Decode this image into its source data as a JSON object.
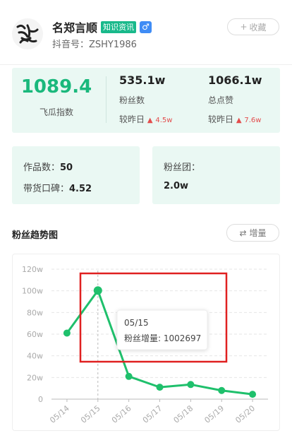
{
  "header": {
    "name": "名郑言顺",
    "tag": "知识资讯",
    "gender_icon": "male-icon",
    "gender_symbol": "♂",
    "douyin_id": "抖音号：ZSHY1986",
    "fav_label": "收藏",
    "avatar_text": "名郑言顺"
  },
  "stats": {
    "feigua_value": "1089.4",
    "feigua_label": "飞瓜指数",
    "fans_value": "535.1w",
    "fans_label": "粉丝数",
    "fans_cmp_label": "较昨日",
    "fans_cmp_value": "4.5w",
    "likes_value": "1066.1w",
    "likes_label": "总点赞",
    "likes_cmp_label": "较昨日",
    "likes_cmp_value": "7.6w"
  },
  "cards": {
    "works_label": "作品数：",
    "works_value": "50",
    "reputation_label": "带货口碑：",
    "reputation_value": "4.52",
    "fan_group_label": "粉丝团：",
    "fan_group_value": "2.0w"
  },
  "trend": {
    "title": "粉丝趋势图",
    "toggle_label": "增量",
    "toggle_icon": "swap-icon"
  },
  "colors": {
    "accent": "#19b98b",
    "line": "#1fc06c",
    "up_arrow": "#e34d4d",
    "highlight_box": "#e02020"
  },
  "chart_data": {
    "type": "line",
    "categories": [
      "05/14",
      "05/15",
      "05/16",
      "05/17",
      "05/18",
      "05/19",
      "05/20"
    ],
    "series": [
      {
        "name": "粉丝增量",
        "values": [
          610000,
          1002697,
          210000,
          110000,
          135000,
          80000,
          45000
        ]
      }
    ],
    "yticks": [
      "0",
      "20w",
      "40w",
      "60w",
      "80w",
      "100w",
      "120w"
    ],
    "ylim": [
      0,
      1200000
    ],
    "grid": true,
    "tooltip": {
      "date": "05/15",
      "label": "粉丝增量:",
      "value": "1002697"
    }
  }
}
